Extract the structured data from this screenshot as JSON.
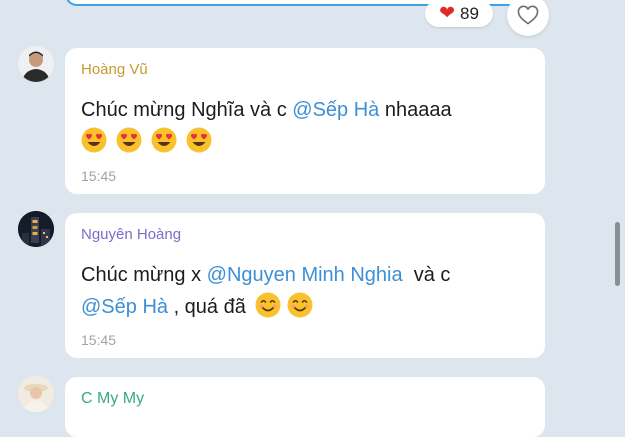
{
  "top_reaction": {
    "emoji": "heart",
    "count": "89"
  },
  "messages": [
    {
      "sender": "Hoàng Vũ",
      "sender_color": "#c79a2c",
      "text_before": "Chúc mừng Nghĩa và c ",
      "mention": "@Sếp Hà",
      "text_after": " nhaaaa",
      "emojis": [
        "heart-eyes-face",
        "heart-eyes-face",
        "heart-eyes-face",
        "heart-eyes-face"
      ],
      "time": "15:45"
    },
    {
      "sender": "Nguyên Hoàng",
      "sender_color": "#7d6bc8",
      "text_before": "Chúc mừng x ",
      "mention": "@Nguyen Minh Nghia",
      "text_middle": "  và c",
      "mention2": "@Sếp Hà",
      "text_after": " , quá đã",
      "emojis": [
        "smiling-face",
        "smiling-face"
      ],
      "time": "15:45"
    },
    {
      "sender": "C My My",
      "sender_color": "#3aa88c"
    }
  ],
  "colors": {
    "background": "#dde5ef",
    "mention": "#3d8fd6",
    "timestamp": "#9ea4ab"
  }
}
